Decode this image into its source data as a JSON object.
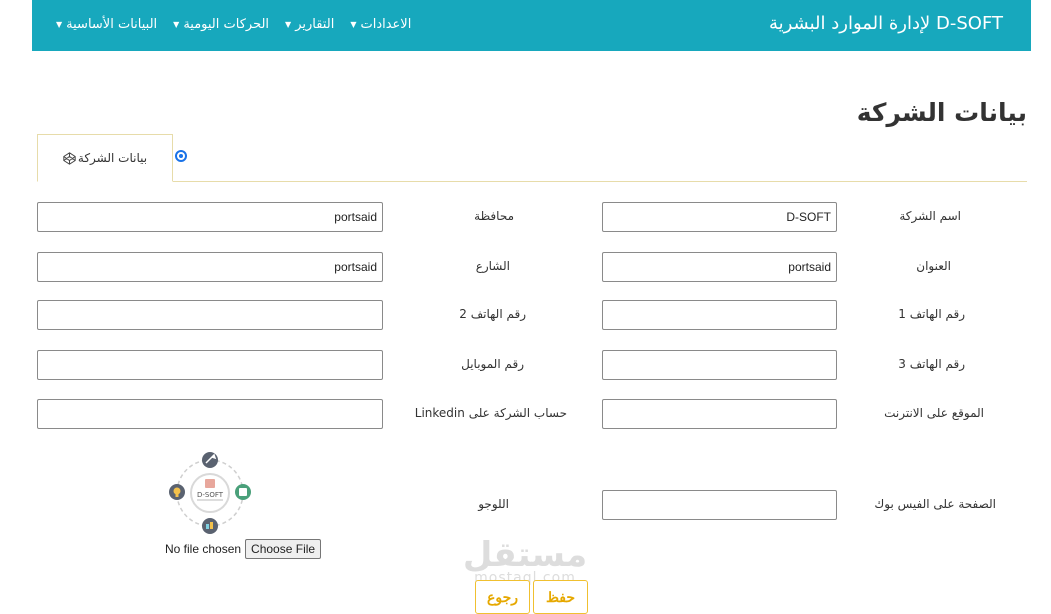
{
  "navbar": {
    "brand": "D-SOFT لإدارة الموارد البشرية",
    "menu": [
      {
        "label": "البيانات الأساسية"
      },
      {
        "label": "الحركات اليومية"
      },
      {
        "label": "التقارير"
      },
      {
        "label": "الاعدادات"
      }
    ]
  },
  "page": {
    "title": "بيانات الشركة",
    "tab_label": "بيانات الشركة"
  },
  "form": {
    "company_name": {
      "label": "اسم الشركة",
      "value": "D-SOFT"
    },
    "governorate": {
      "label": "محافظة",
      "value": "portsaid"
    },
    "address": {
      "label": "العنوان",
      "value": "portsaid"
    },
    "street": {
      "label": "الشارع",
      "value": "portsaid"
    },
    "phone1": {
      "label": "رقم الهاتف 1",
      "value": ""
    },
    "phone2": {
      "label": "رقم الهاتف 2",
      "value": ""
    },
    "phone3": {
      "label": "رقم الهاتف 3",
      "value": ""
    },
    "mobile": {
      "label": "رقم الموبايل",
      "value": ""
    },
    "website": {
      "label": "الموقع على الانترنت",
      "value": ""
    },
    "linkedin": {
      "label": "حساب الشركة على Linkedin",
      "value": ""
    },
    "facebook": {
      "label": "الصفحة على الفيس بوك",
      "value": ""
    },
    "logo": {
      "label": "اللوجو",
      "file_status": "No file chosen",
      "choose_label": "Choose File",
      "logo_text": "D-SOFT"
    }
  },
  "actions": {
    "save": "حفظ",
    "back": "رجوع"
  },
  "watermark": {
    "arabic": "مستقل",
    "latin": "mostaql.com"
  },
  "colors": {
    "navbar": "#17a8bd",
    "button_accent": "#e6a800",
    "tab_border": "#e7dcaa"
  }
}
